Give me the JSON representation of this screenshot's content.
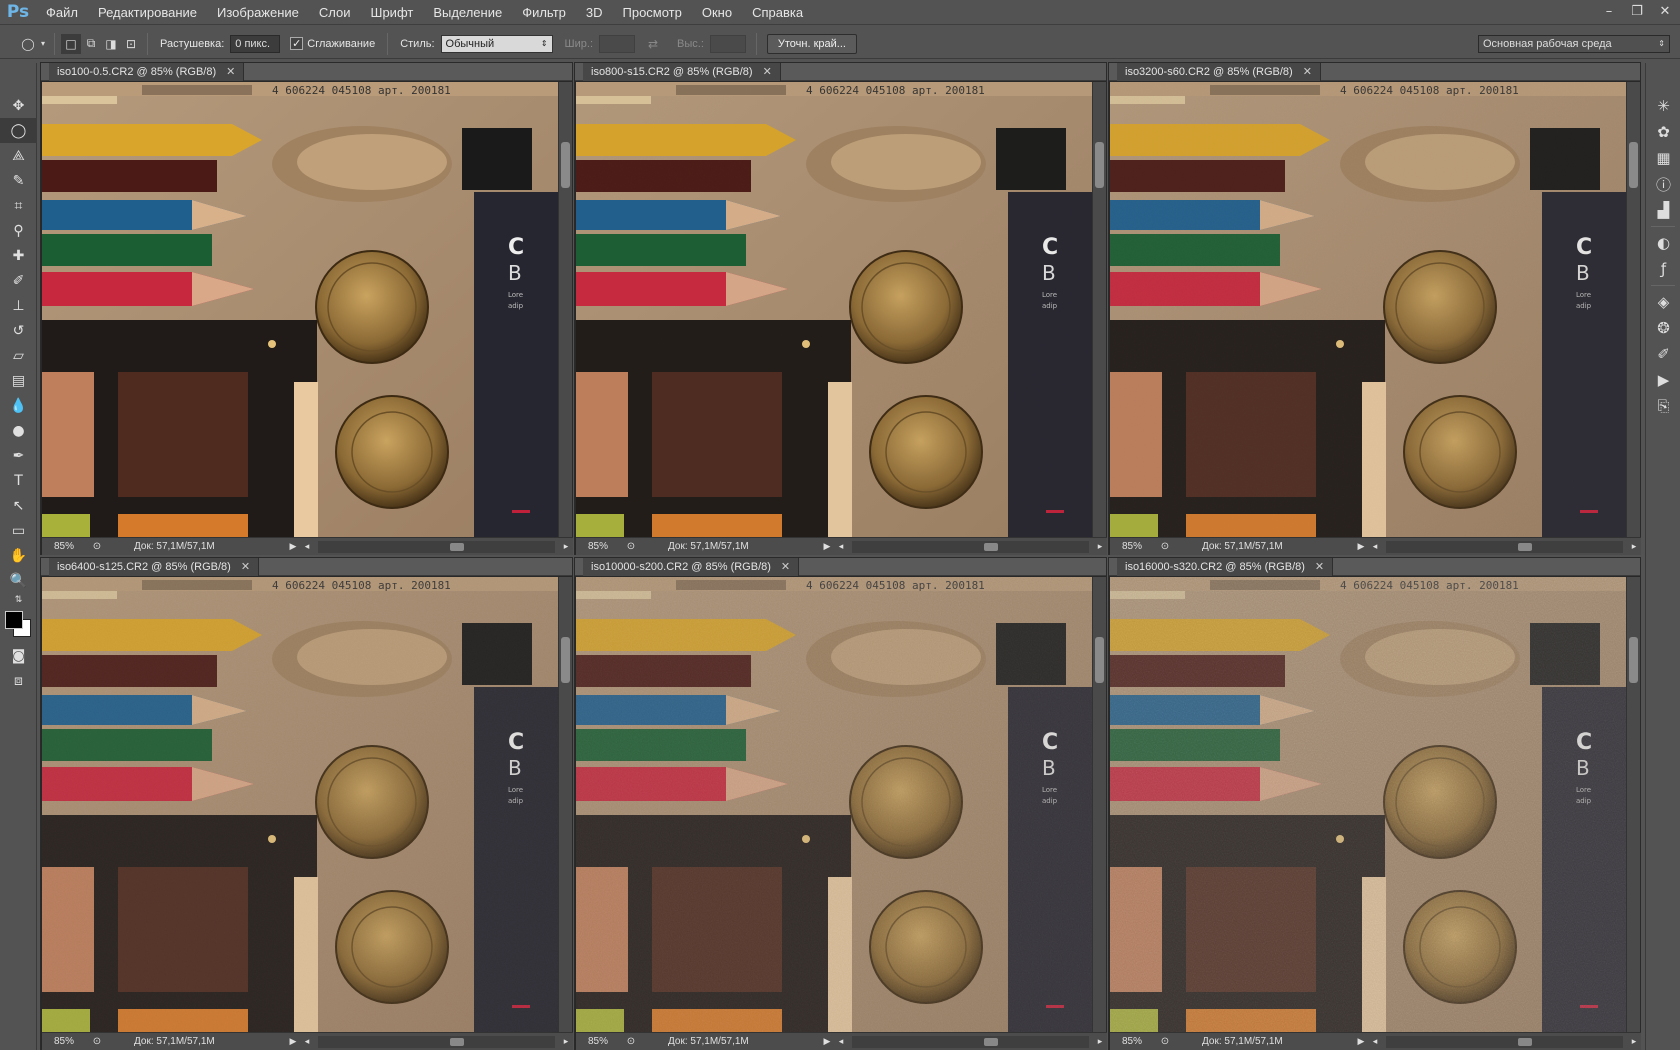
{
  "app": {
    "logo": "Ps"
  },
  "menu": [
    "Файл",
    "Редактирование",
    "Изображение",
    "Слои",
    "Шрифт",
    "Выделение",
    "Фильтр",
    "3D",
    "Просмотр",
    "Окно",
    "Справка"
  ],
  "options": {
    "feather_label": "Растушевка:",
    "feather_value": "0 пикс.",
    "antialias_label": "Сглаживание",
    "antialias_checked": true,
    "style_label": "Стиль:",
    "style_value": "Обычный",
    "width_label": "Шир.:",
    "height_label": "Выс.:",
    "refine_button": "Уточн. край...",
    "workspace": "Основная рабочая среда"
  },
  "documents": [
    {
      "title": "iso100-0.5.CR2 @ 85% (RGB/8)",
      "zoom": "85%",
      "doc": "Док: 57,1M/57,1M",
      "noise": 0
    },
    {
      "title": "iso800-s15.CR2 @ 85% (RGB/8)",
      "zoom": "85%",
      "doc": "Док: 57,1M/57,1M",
      "noise": 0.1
    },
    {
      "title": "iso3200-s60.CR2 @ 85% (RGB/8)",
      "zoom": "85%",
      "doc": "Док: 57,1M/57,1M",
      "noise": 0.25
    },
    {
      "title": "iso6400-s125.CR2 @ 85% (RGB/8)",
      "zoom": "85%",
      "doc": "Док: 57,1M/57,1M",
      "noise": 0.4
    },
    {
      "title": "iso10000-s200.CR2 @ 85% (RGB/8)",
      "zoom": "85%",
      "doc": "Док: 57,1M/57,1M",
      "noise": 0.6
    },
    {
      "title": "iso16000-s320.CR2 @ 85% (RGB/8)",
      "zoom": "85%",
      "doc": "Док: 57,1M/57,1M",
      "noise": 0.8
    }
  ],
  "photo": {
    "barcode_text": "4 606224 045108 арт. 200181",
    "box_letter_1": "C",
    "box_letter_2": "B",
    "box_small_1": "Lore",
    "box_small_2": "adip"
  },
  "colors": {
    "accent": "#6fb6e8",
    "ui_bg": "#535353",
    "canvas_bg": "#a88d6e"
  }
}
